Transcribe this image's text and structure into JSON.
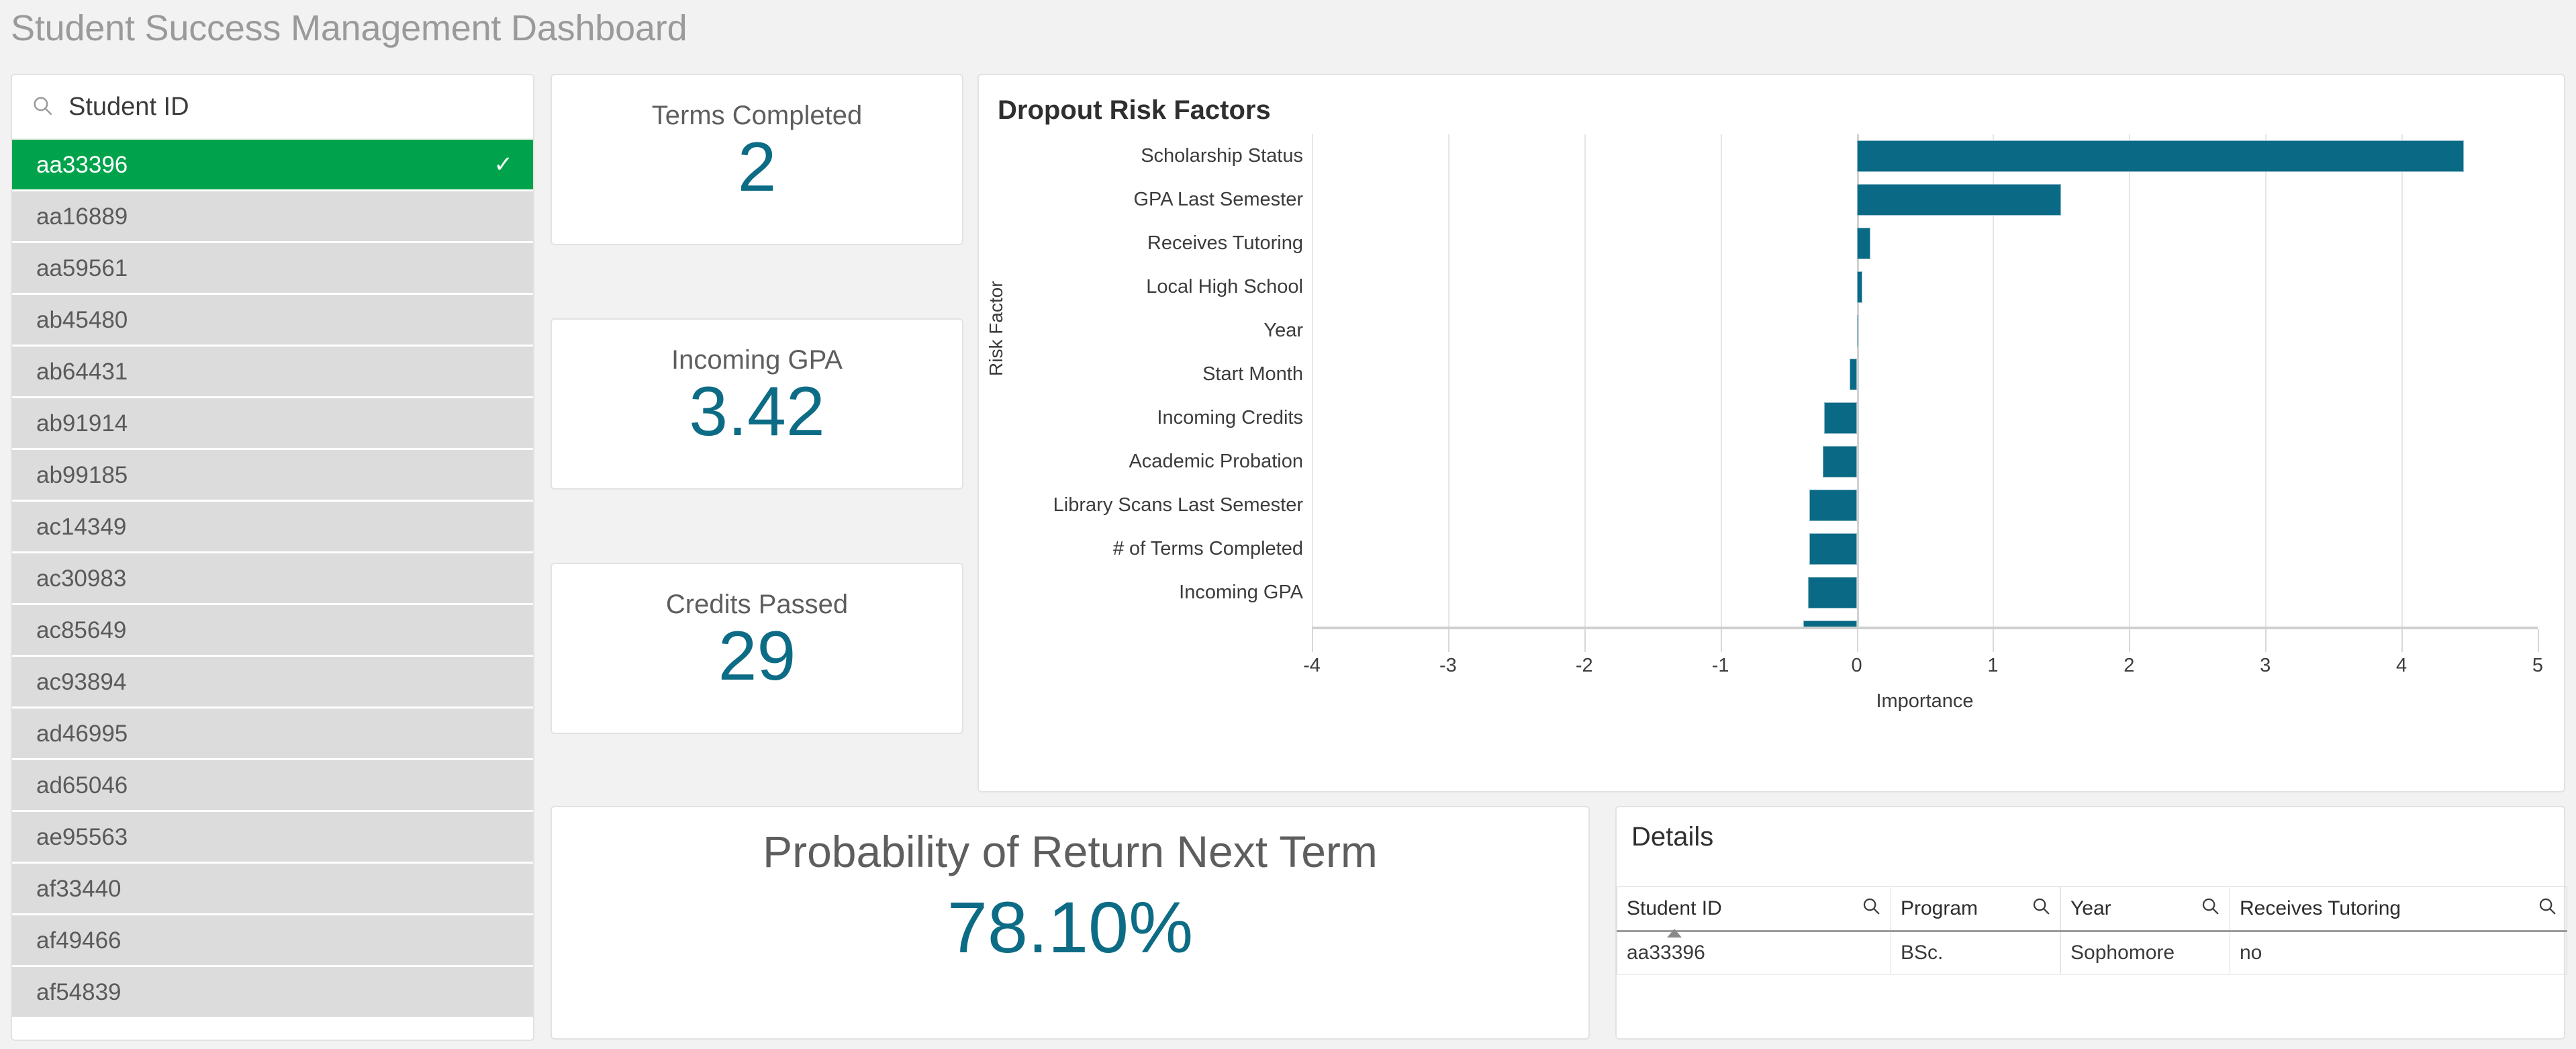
{
  "header": {
    "title": "Student Success Management Dashboard"
  },
  "listbox": {
    "search": {
      "icon": "search-icon",
      "label": "Student ID"
    },
    "selected_check": "✓",
    "items": [
      {
        "id": "aa33396",
        "selected": true
      },
      {
        "id": "aa16889",
        "selected": false
      },
      {
        "id": "aa59561",
        "selected": false
      },
      {
        "id": "ab45480",
        "selected": false
      },
      {
        "id": "ab64431",
        "selected": false
      },
      {
        "id": "ab91914",
        "selected": false
      },
      {
        "id": "ab99185",
        "selected": false
      },
      {
        "id": "ac14349",
        "selected": false
      },
      {
        "id": "ac30983",
        "selected": false
      },
      {
        "id": "ac85649",
        "selected": false
      },
      {
        "id": "ac93894",
        "selected": false
      },
      {
        "id": "ad46995",
        "selected": false
      },
      {
        "id": "ad65046",
        "selected": false
      },
      {
        "id": "ae95563",
        "selected": false
      },
      {
        "id": "af33440",
        "selected": false
      },
      {
        "id": "af49466",
        "selected": false
      },
      {
        "id": "af54839",
        "selected": false
      }
    ]
  },
  "kpis": {
    "terms_completed": {
      "title": "Terms Completed",
      "value": "2"
    },
    "incoming_gpa": {
      "title": "Incoming GPA",
      "value": "3.42"
    },
    "credits_passed": {
      "title": "Credits Passed",
      "value": "29"
    },
    "probability": {
      "title": "Probability of Return Next Term",
      "value": "78.10%"
    }
  },
  "chart_card": {
    "title": "Dropout Risk Factors"
  },
  "chart_data": {
    "type": "bar",
    "orientation": "horizontal",
    "title": "Dropout Risk Factors",
    "xlabel": "Importance",
    "ylabel": "Risk Factor",
    "xlim": [
      -4,
      5
    ],
    "xticks": [
      -4,
      -3,
      -2,
      -1,
      0,
      1,
      2,
      3,
      4,
      5
    ],
    "xtick_labels": [
      "-4",
      "-3",
      "-2",
      "-1",
      "0",
      "1",
      "2",
      "3",
      "4",
      "5"
    ],
    "grid": true,
    "legend": "none",
    "bar_color": "#0a6a86",
    "categories": [
      "Scholarship Status",
      "GPA Last Semester",
      "Receives Tutoring",
      "Local High School",
      "Year",
      "Start Month",
      "Incoming Credits",
      "Academic Probation",
      "Library Scans Last Semester",
      "# of Terms Completed",
      "Incoming GPA"
    ],
    "values": [
      4.46,
      1.5,
      0.1,
      0.04,
      0.0,
      -0.05,
      -0.24,
      -0.25,
      -0.35,
      -0.35,
      -0.36
    ],
    "clipped_rows": [
      {
        "label": "",
        "value": -0.39
      }
    ]
  },
  "details": {
    "title": "Details",
    "search_icon": "search-icon",
    "sort_column": "Student ID",
    "sort_direction": "ascending",
    "columns": [
      "Student ID",
      "Program",
      "Year",
      "Receives Tutoring"
    ],
    "rows": [
      {
        "student_id": "aa33396",
        "program": "BSc.",
        "year": "Sophomore",
        "receives_tutoring": "no"
      }
    ]
  },
  "colors": {
    "accent_teal": "#0a6a86",
    "selection_green": "#00a34b",
    "page_background": "#f2f2f2",
    "card_background": "#ffffff",
    "list_item_background": "#dcdcdc"
  }
}
